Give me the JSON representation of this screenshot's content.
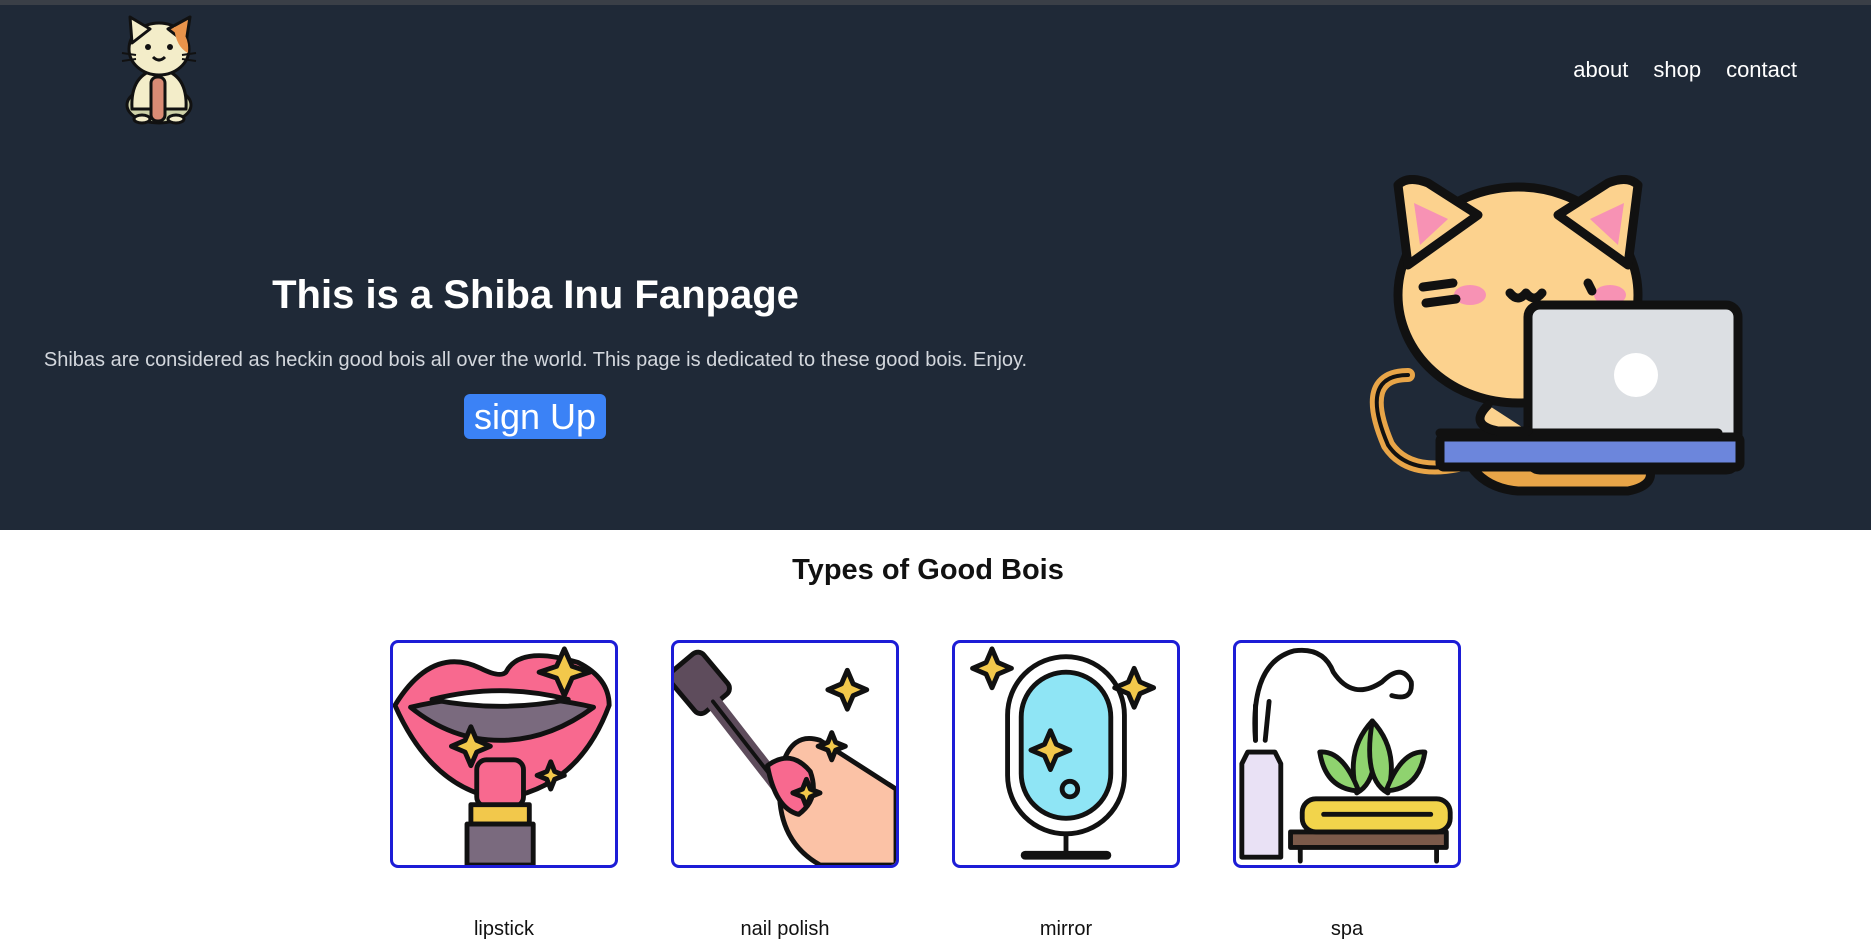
{
  "nav": {
    "about": "about",
    "shop": "shop",
    "contact": "contact"
  },
  "hero": {
    "title": "This is a Shiba Inu Fanpage",
    "subtitle": "Shibas are considered as heckin good bois all over the world. This page is dedicated to these good bois. Enjoy.",
    "button_label": "sign Up"
  },
  "section": {
    "title": "Types of Good Bois"
  },
  "cards": [
    {
      "icon": "lipstick-icon",
      "caption": "lipstick"
    },
    {
      "icon": "nail-polish-icon",
      "caption": "nail polish"
    },
    {
      "icon": "mirror-icon",
      "caption": "mirror"
    },
    {
      "icon": "spa-aroma-icon",
      "caption": "spa"
    }
  ],
  "colors": {
    "hero_bg": "#1f2937",
    "button": "#3b82f6",
    "card_border": "#1d1dd6"
  }
}
